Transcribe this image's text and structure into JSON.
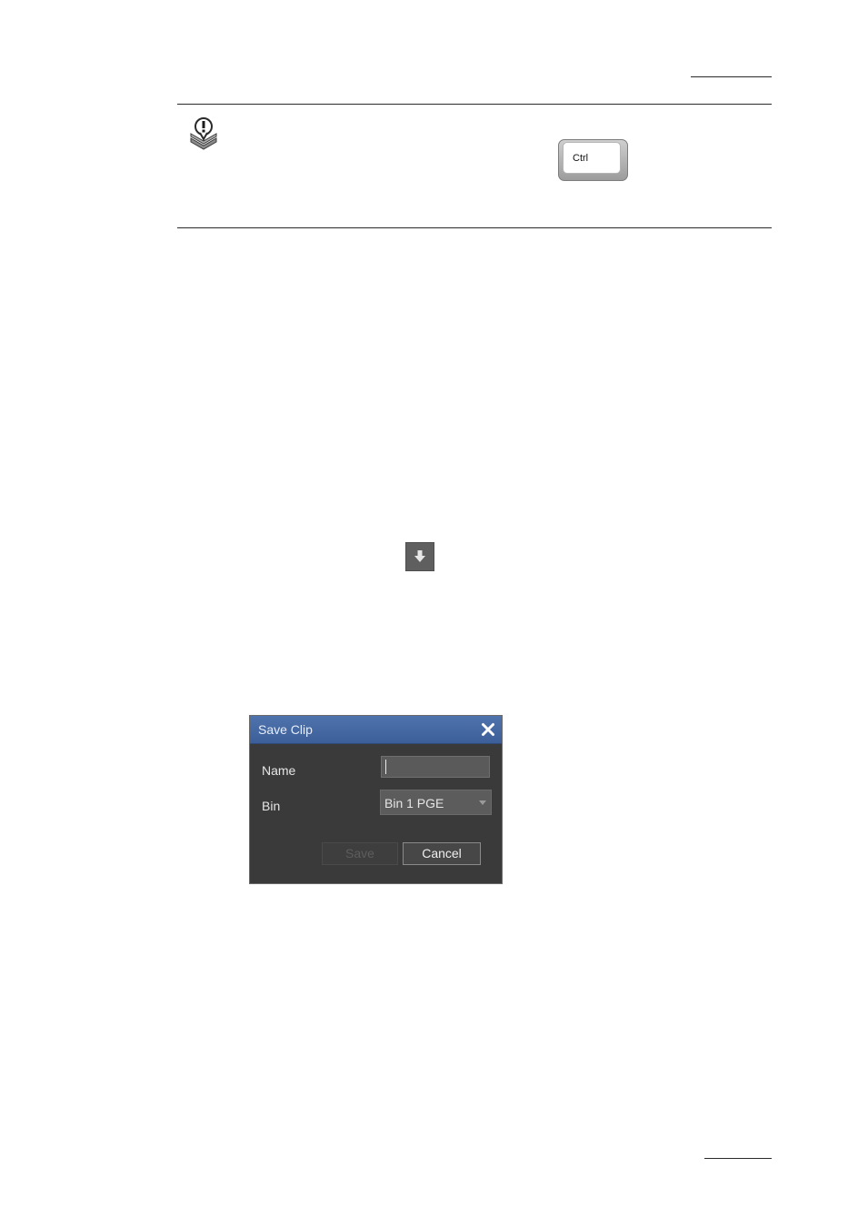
{
  "note": {
    "icon": "note-exclamation-icon",
    "ctrl_key_label": "Ctrl"
  },
  "inline_button": {
    "icon": "down-arrow-icon"
  },
  "save_clip_dialog": {
    "title": "Save Clip",
    "close_icon": "close-icon",
    "name_label": "Name",
    "name_value": "",
    "bin_label": "Bin",
    "bin_value": "Bin 1 PGE",
    "save_label": "Save",
    "cancel_label": "Cancel",
    "colors": {
      "titlebar": "#4a6ca6",
      "body": "#3a3a3a"
    }
  }
}
